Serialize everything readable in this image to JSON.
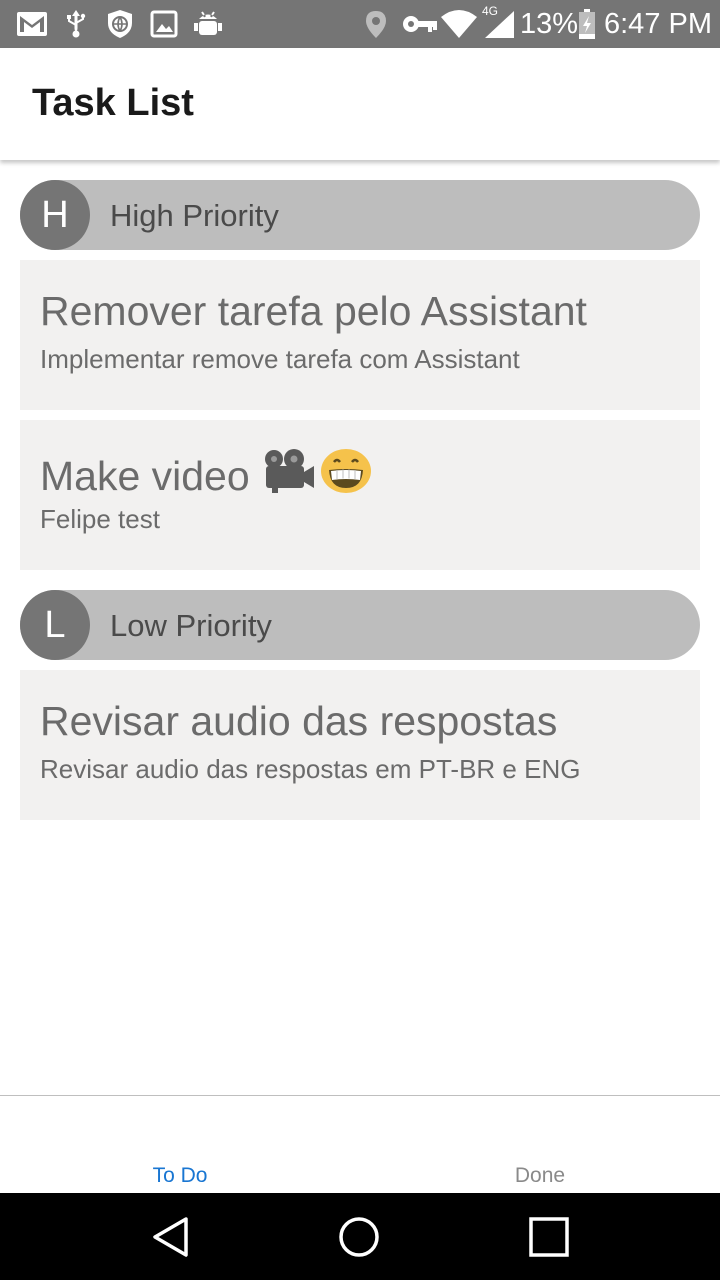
{
  "status_bar": {
    "icons": [
      "gmail-icon",
      "usb-icon",
      "vpn-shield-icon",
      "gallery-icon",
      "android-debug-icon",
      "location-icon",
      "key-icon",
      "wifi-icon",
      "signal-4g-icon",
      "battery-icon"
    ],
    "network_label": "4G",
    "battery_text": "13%",
    "time": "6:47 PM",
    "bg_color": "#757575"
  },
  "app_bar": {
    "title": "Task List"
  },
  "sections": [
    {
      "avatar_letter": "H",
      "label": "High Priority",
      "tasks": [
        {
          "title": "Remover tarefa pelo Assistant",
          "description": "Implementar remove tarefa com Assistant"
        },
        {
          "title": "Make video",
          "title_emojis": [
            "movie-camera-emoji",
            "grinning-face-emoji"
          ],
          "description": "Felipe test"
        }
      ]
    },
    {
      "avatar_letter": "L",
      "label": "Low Priority",
      "tasks": [
        {
          "title": "Revisar audio das respostas",
          "description": "Revisar audio das respostas em PT-BR e ENG"
        }
      ]
    }
  ],
  "tabs": [
    {
      "label": "To Do",
      "active": true,
      "color": "#1976d2"
    },
    {
      "label": "Done",
      "active": false,
      "color": "#8a8a8a"
    }
  ],
  "nav_bar": {
    "icons": [
      "back-icon",
      "home-icon",
      "recents-icon"
    ]
  },
  "colors": {
    "header_pill": "#bdbdbd",
    "avatar": "#757575",
    "card": "#f2f1f0",
    "accent": "#1976d2"
  }
}
